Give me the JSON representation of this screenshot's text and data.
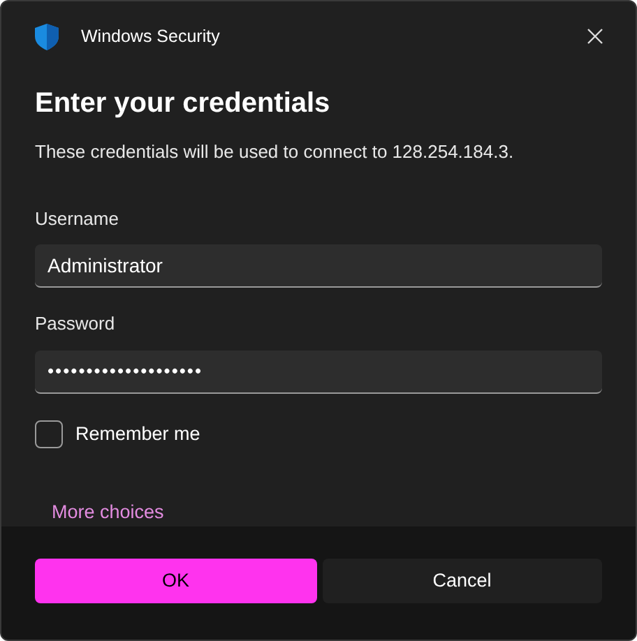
{
  "window": {
    "title": "Windows Security"
  },
  "heading": "Enter your credentials",
  "description": "These credentials will be used to connect to 128.254.184.3.",
  "fields": [
    {
      "label": "Username",
      "value": "Administrator",
      "kind": "text"
    },
    {
      "label": "Password",
      "value": "••••••••••••••••••••",
      "kind": "password"
    }
  ],
  "remember": {
    "label": "Remember me",
    "checked": false
  },
  "more_choices": "More choices",
  "buttons": [
    {
      "label": "OK",
      "kind": "primary"
    },
    {
      "label": "Cancel",
      "kind": "secondary"
    }
  ]
}
